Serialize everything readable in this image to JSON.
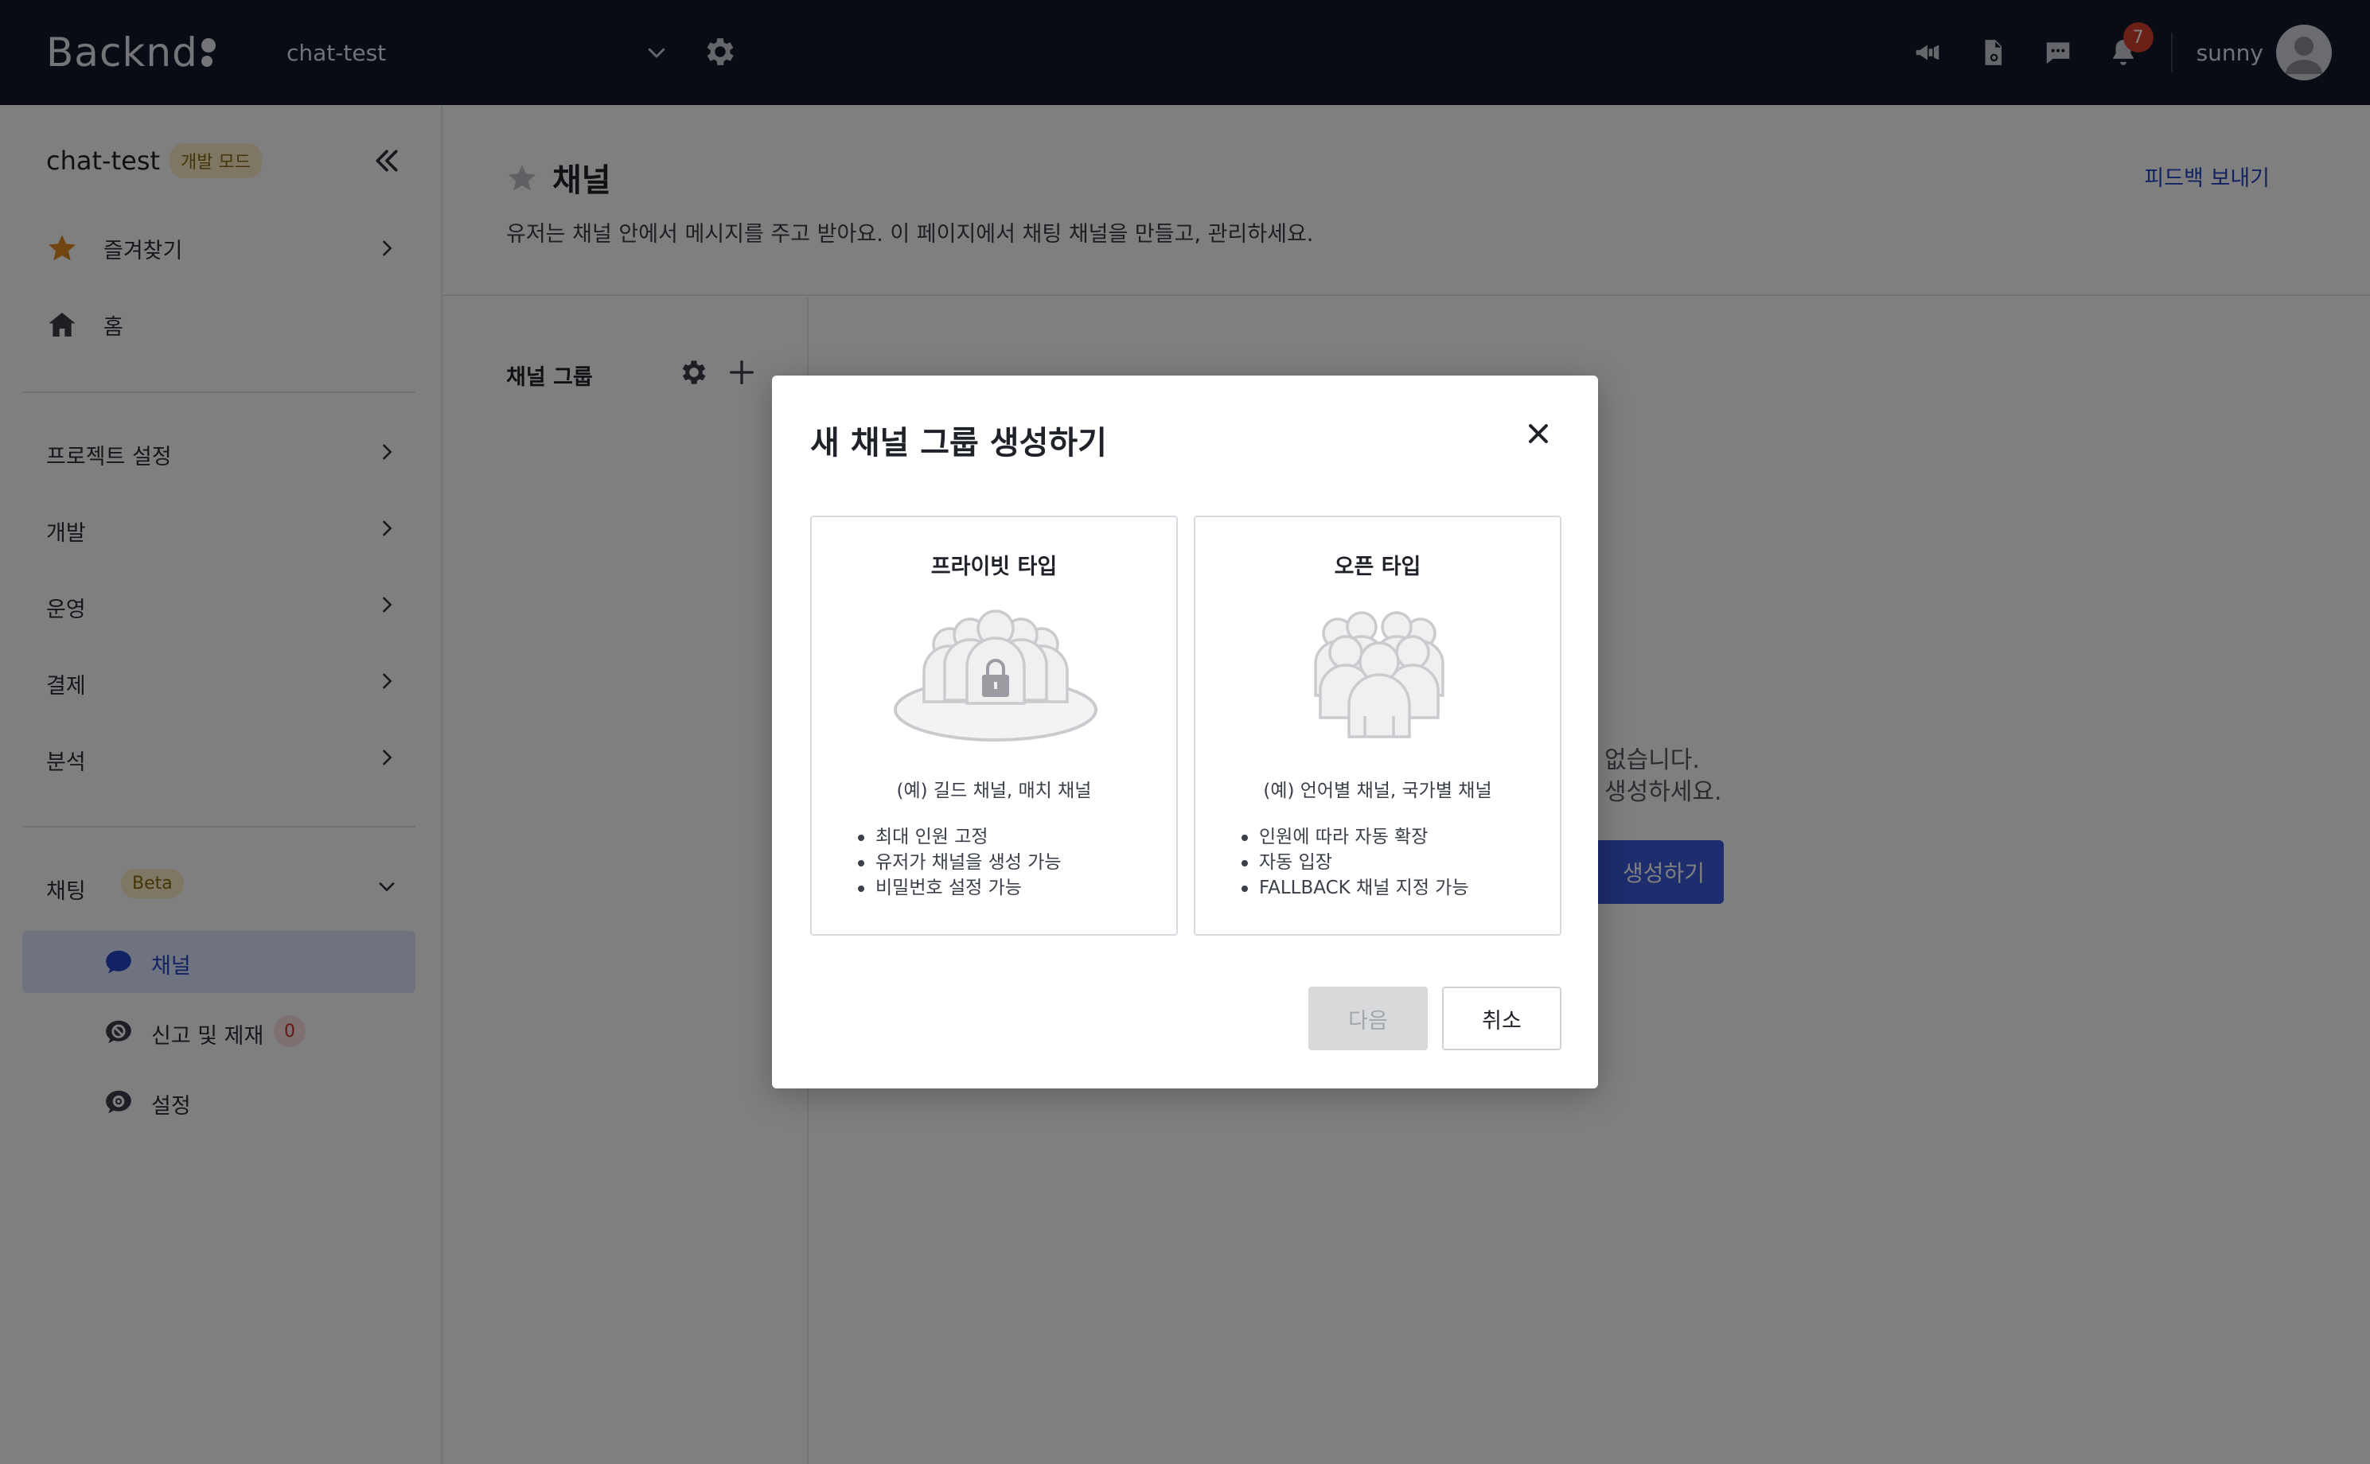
{
  "topbar": {
    "logo_text": "Backnd",
    "project_name": "chat-test",
    "notification_count": "7",
    "username": "sunny",
    "icons": [
      "megaphone-icon",
      "document-icon",
      "chat-support-icon",
      "bell-icon"
    ]
  },
  "sidebar": {
    "project_title": "chat-test",
    "mode_badge": "개발 모드",
    "favorites_label": "즐겨찾기",
    "home_label": "홈",
    "sections": {
      "project_settings": "프로젝트 설정",
      "dev": "개발",
      "ops": "운영",
      "payment": "결제",
      "analytics": "분석"
    },
    "chat": {
      "label": "채팅",
      "badge": "Beta",
      "items": {
        "channel": "채널",
        "report": "신고 및 제재",
        "report_count": "0",
        "settings": "설정"
      }
    }
  },
  "main": {
    "title": "채널",
    "description": "유저는 채널 안에서 메시지를 주고 받아요. 이 페이지에서 채팅 채널을 만들고, 관리하세요.",
    "feedback_link": "피드백 보내기",
    "groups_title": "채널 그룹",
    "empty_line1": "없습니다.",
    "empty_line2": "생성하세요.",
    "create_button": "생성하기"
  },
  "modal": {
    "title": "새 채널 그룹 생성하기",
    "private_card": {
      "title": "프라이빗 타입",
      "example": "(예) 길드 채널, 매치 채널",
      "features": [
        "최대 인원 고정",
        "유저가 채널을 생성 가능",
        "비밀번호 설정 가능"
      ]
    },
    "open_card": {
      "title": "오픈 타입",
      "example": "(예) 언어별 채널, 국가별 채널",
      "features": [
        "인원에 따라 자동 확장",
        "자동 입장",
        "FALLBACK 채널 지정 가능"
      ]
    },
    "next_button": "다음",
    "cancel_button": "취소"
  },
  "colors": {
    "topbar_bg": "#121829",
    "accent": "#3b5bdb",
    "link": "#2446c9",
    "notif_badge": "#d6402f",
    "favorite_star": "#e08a1e"
  }
}
